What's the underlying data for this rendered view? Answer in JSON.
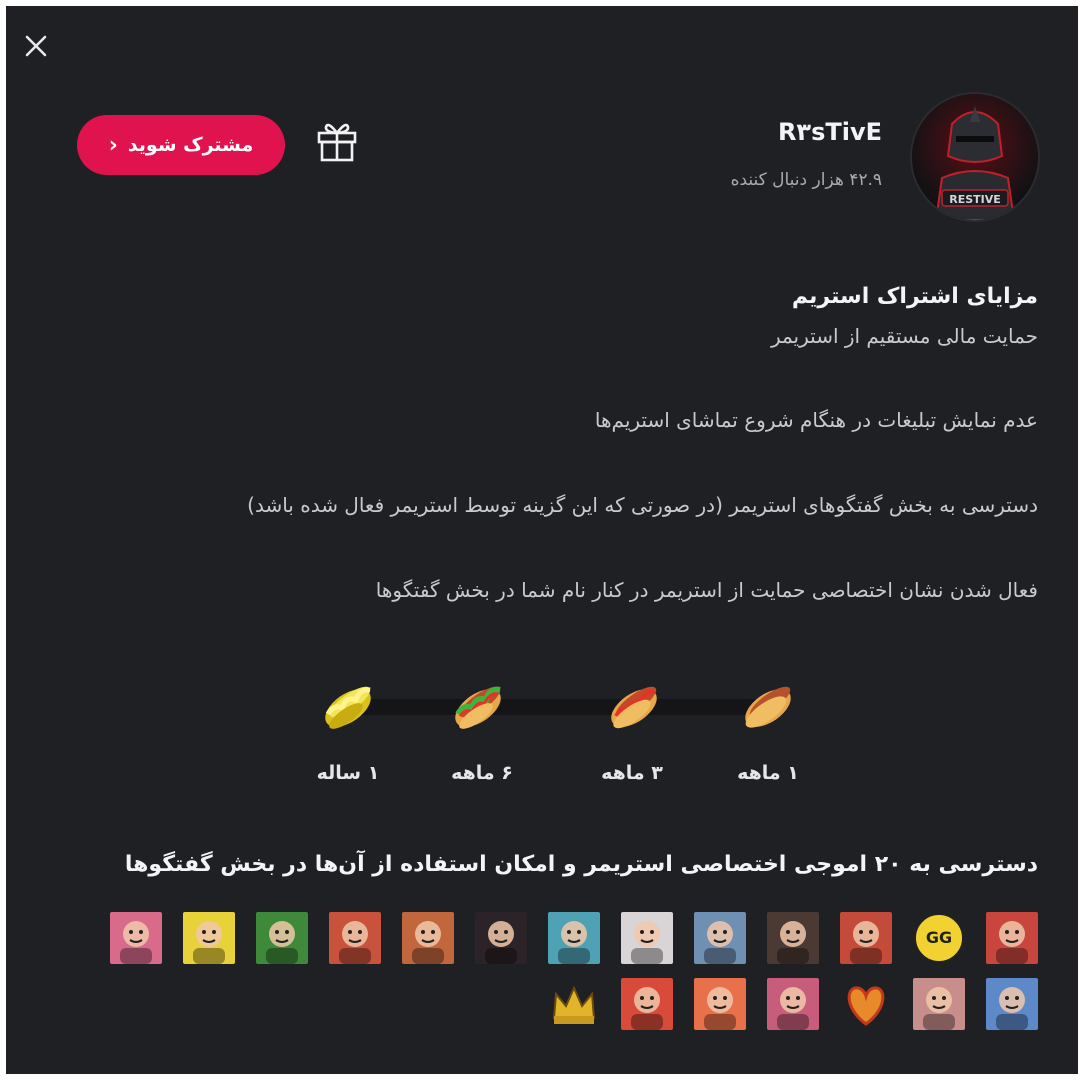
{
  "header": {
    "channel_name": "R۳sTivE",
    "followers": "۴۲.۹ هزار دنبال کننده",
    "subscribe_label": "مشترک شوید",
    "subscribe_chevron": "‹"
  },
  "benefits": {
    "title": "مزایای اشتراک استریم",
    "items": [
      "حمایت مالی مستقیم از استریمر",
      "عدم نمایش تبلیغات در هنگام شروع تماشای استریم‌ها",
      "دسترسی به بخش گفتگوهای استریمر (در صورتی که این گزینه توسط استریمر فعال شده باشد)",
      "فعال شدن نشان اختصاصی حمایت از استریمر در کنار نام شما در بخش گفتگوها"
    ]
  },
  "tiers": [
    {
      "label": "۱ ماهه",
      "icon": "hotdog-plain-icon"
    },
    {
      "label": "۳ ماهه",
      "icon": "hotdog-ketchup-icon"
    },
    {
      "label": "۶ ماهه",
      "icon": "hotdog-deluxe-icon"
    },
    {
      "label": "۱ ساله",
      "icon": "hotdog-gold-icon"
    }
  ],
  "emotes": {
    "title": "دسترسی به ۲۰ اموجی اختصاصی استریمر و امکان استفاده از آن‌ها در بخش گفتگوها",
    "count": 20,
    "gg_text": "GG",
    "colors": [
      "#c9463f",
      "#e3c23a",
      "#c44a3a",
      "#4b3a33",
      "#6f8fb3",
      "#d9d4d6",
      "#4fa2b4",
      "#2b2327",
      "#c2663e",
      "#c8523b",
      "#3f8a3a",
      "#e8d23a",
      "#d86a8a",
      "#5d89c9",
      "#c78e8c",
      "#4a4a4a",
      "#c85c7b",
      "#e8704a",
      "#d84a3a",
      "#d7b03b"
    ]
  },
  "colors": {
    "accent": "#e0134f",
    "background": "#1f2024"
  }
}
